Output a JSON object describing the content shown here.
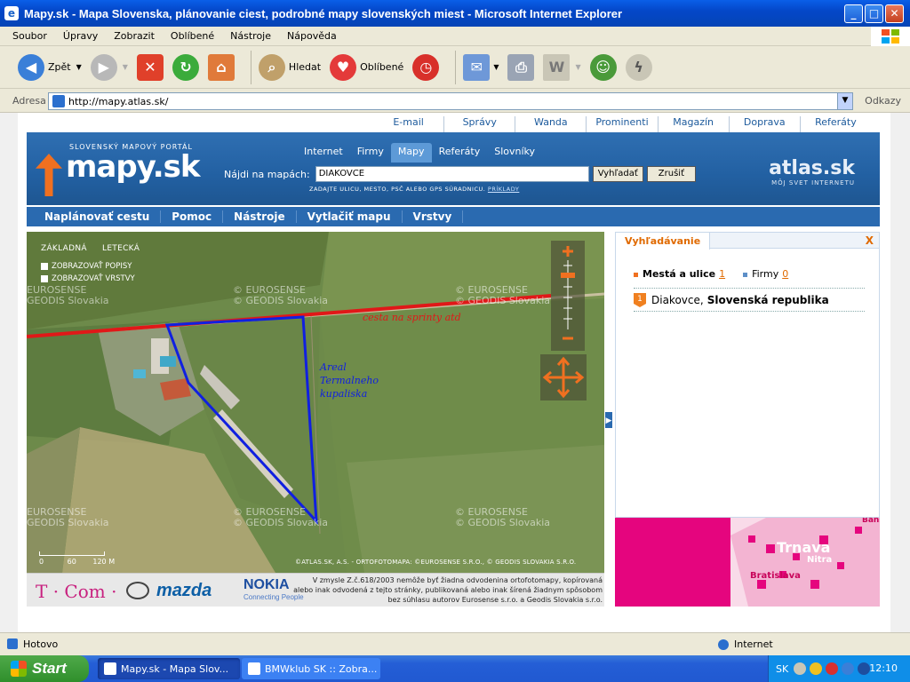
{
  "window": {
    "title": "Mapy.sk - Mapa Slovenska, plánovanie ciest, podrobné mapy slovenských miest - Microsoft Internet Explorer"
  },
  "menu": [
    "Soubor",
    "Úpravy",
    "Zobrazit",
    "Oblíbené",
    "Nástroje",
    "Nápověda"
  ],
  "toolbar": {
    "back_label": "Zpět",
    "search_label": "Hledat",
    "favorites_label": "Oblíbené"
  },
  "address": {
    "label": "Adresa",
    "url": "http://mapy.atlas.sk/",
    "links_label": "Odkazy"
  },
  "site": {
    "top_links": [
      "E-mail",
      "Správy",
      "Wanda",
      "Prominenti",
      "Magazín",
      "Doprava",
      "Referáty"
    ],
    "logo_tagline": "SLOVENSKÝ MAPOVÝ PORTÁL",
    "logo_text": "mapy.sk",
    "search_tabs": [
      "Internet",
      "Firmy",
      "Mapy",
      "Referáty",
      "Slovníky"
    ],
    "search_label": "Nájdi na mapách:",
    "search_value": "DIAKOVCE",
    "search_button": "Vyhľadať",
    "cancel_button": "Zrušiť",
    "hint_text": "ZADAJTE ULICU, MESTO, PSČ ALEBO GPS SÚRADNICU.",
    "hint_link": "PRÍKLADY",
    "atlas_logo": "atlas.sk",
    "atlas_tagline": "MÔJ SVET INTERNETU",
    "nav": [
      "Naplánovať cestu",
      "Pomoc",
      "Nástroje",
      "Vytlačiť mapu",
      "Vrstvy"
    ]
  },
  "map": {
    "tabs": [
      "ZÁKLADNÁ",
      "LETECKÁ"
    ],
    "options": [
      "ZOBRAZOVAŤ POPISY",
      "ZOBRAZOVAŤ VRSTVY"
    ],
    "watermark_1": "© EUROSENSE",
    "watermark_2": "© GEODIS Slovakia",
    "watermark_3": "EUROSENSE",
    "watermark_4": "GEODIS Slovakia",
    "annotation_road": "cesta na sprinty atd",
    "annotation_area_1": "Areal",
    "annotation_area_2": "Termalneho",
    "annotation_area_3": "kupaliska",
    "scale": [
      "0",
      "60",
      "120 M"
    ],
    "copyright": "©ATLAS.SK, A.S. - ORTOFOTOMAPA: ©EUROSENSE S.R.O., © GEODIS SLOVAKIA S.R.O."
  },
  "ads": {
    "tcom": "T · Com ·",
    "mazda": "mazda",
    "nokia": "NOKIA",
    "nokia_sub": "Connecting People",
    "legal": "V zmysle Z.č.618/2003 nemôže byť žiadna odvodenina ortofotomapy, kopírovaná alebo inak odvodená z tejto stránky, publikovaná alebo inak šírená žiadnym spôsobom bez súhlasu autorov Eurosense s.r.o. a Geodis Slovakia s.r.o."
  },
  "panel": {
    "tab": "Vyhľadávanie",
    "close": "X",
    "cat_cities": "Mestá a ulice",
    "cat_cities_count": "1",
    "cat_firms": "Firmy",
    "cat_firms_count": "0",
    "result_index": "1",
    "result_place": "Diakovce,",
    "result_country": "Slovenská republika"
  },
  "ad2": {
    "city_1": "Trnava",
    "city_2": "Nitra",
    "city_3": "Bratislava",
    "city_4": "Bans"
  },
  "status": {
    "text": "Hotovo",
    "zone": "Internet"
  },
  "taskbar": {
    "start": "Start",
    "task_1": "Mapy.sk - Mapa Slov...",
    "task_2": "BMWklub SK :: Zobra...",
    "lang": "SK",
    "clock": "12:10"
  },
  "colors": {
    "site_blue": "#2a6ab0",
    "accent_orange": "#f07020",
    "boundary_blue": "#1020e0",
    "road_red": "#e01818",
    "ad_magenta": "#e5057e"
  }
}
